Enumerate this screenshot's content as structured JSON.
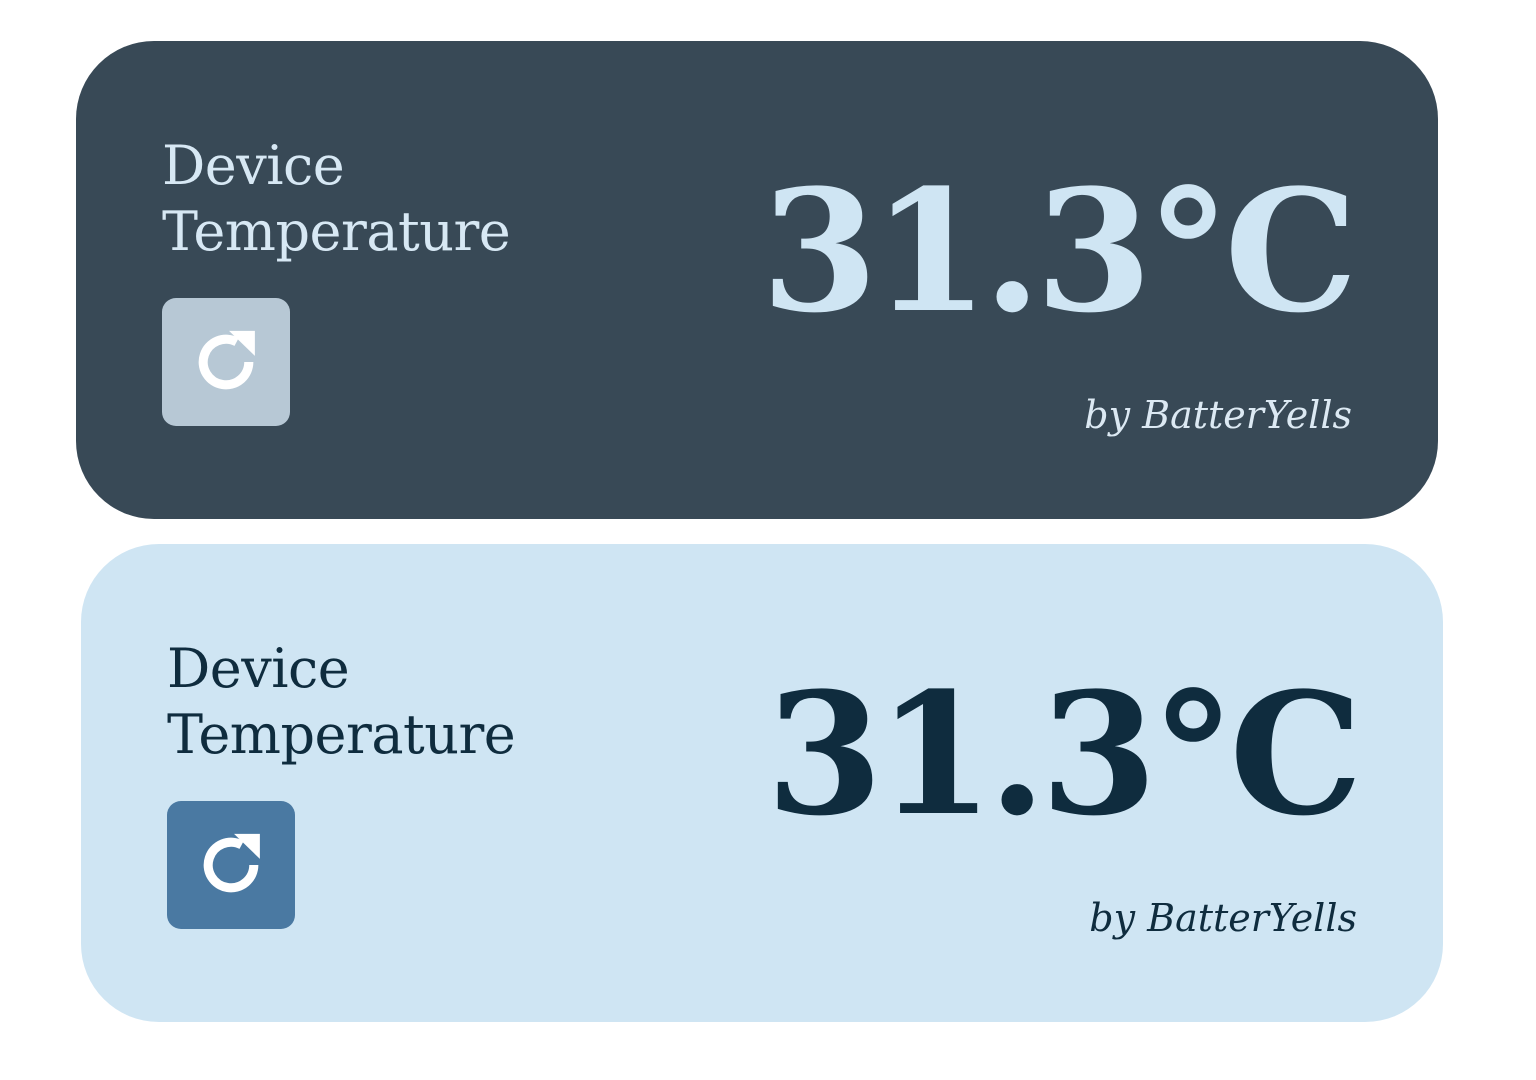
{
  "cards": [
    {
      "theme": "dark",
      "label_line1": "Device",
      "label_line2": "Temperature",
      "value": "31.3°C",
      "credit": "by BatterYells",
      "button_icon": "refresh-icon",
      "colors": {
        "background": "#384956",
        "text": "#cfe5f3",
        "button": "#b7c8d5"
      }
    },
    {
      "theme": "light",
      "label_line1": "Device",
      "label_line2": "Temperature",
      "value": "31.3°C",
      "credit": "by BatterYells",
      "button_icon": "refresh-icon",
      "colors": {
        "background": "#cfe5f3",
        "text": "#0f2c3e",
        "button": "#4a79a2"
      }
    }
  ]
}
